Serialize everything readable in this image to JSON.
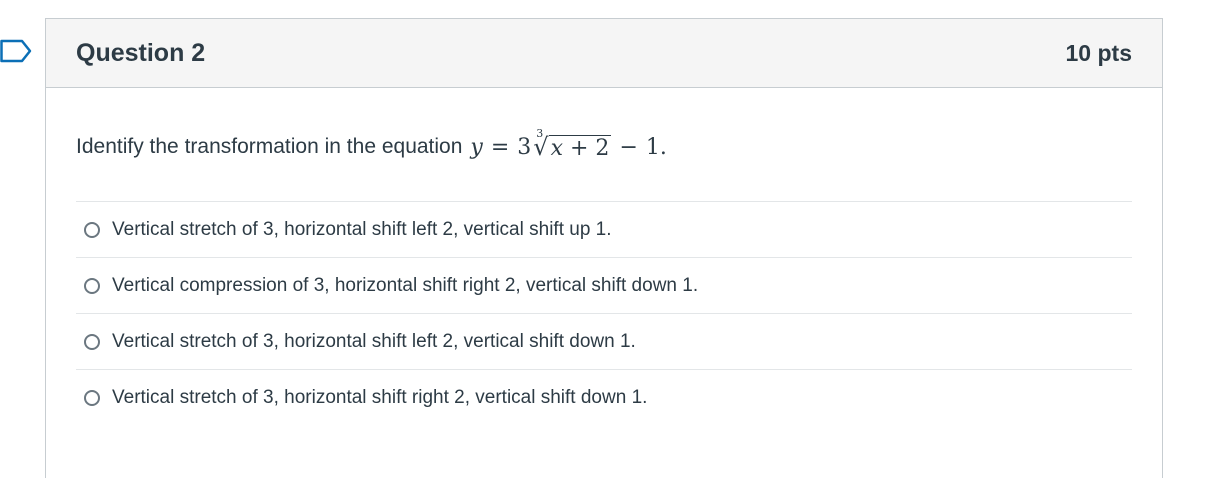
{
  "question": {
    "title": "Question 2",
    "points": "10 pts",
    "prompt": "Identify the transformation in the equation",
    "equation": {
      "y": "y",
      "equals": "=",
      "coef": "3",
      "index": "3",
      "radicand": "x + 2",
      "minus": "−",
      "constant": "1",
      "period": "."
    }
  },
  "answers": [
    {
      "label": "Vertical stretch of 3, horizontal shift left 2, vertical shift up 1."
    },
    {
      "label": "Vertical compression of 3, horizontal shift right 2, vertical shift down 1."
    },
    {
      "label": "Vertical stretch of 3, horizontal shift left 2, vertical shift down 1."
    },
    {
      "label": "Vertical stretch of 3, horizontal shift right 2, vertical shift down 1."
    }
  ],
  "icons": {
    "flag": "bookmark-flag-icon",
    "radio": "radio-button-unchecked"
  },
  "colors": {
    "text": "#2d3b45",
    "header_bg": "#f5f5f5",
    "border": "#c7cdd1",
    "flag": "#0b6fb6"
  }
}
